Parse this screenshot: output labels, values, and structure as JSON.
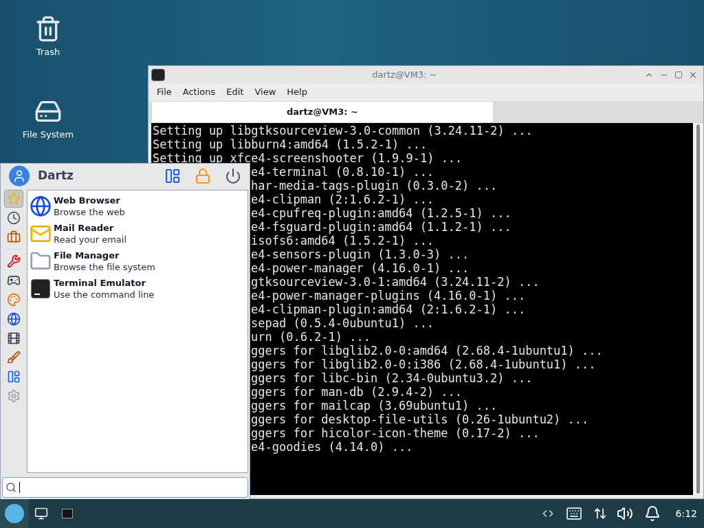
{
  "desktop_icons": [
    {
      "label": "Trash",
      "kind": "trash"
    },
    {
      "label": "File System",
      "kind": "drive"
    }
  ],
  "terminal": {
    "title": "dartz@VM3: ~",
    "menu": [
      "File",
      "Actions",
      "Edit",
      "View",
      "Help"
    ],
    "tabs": [
      {
        "label": "dartz@VM3: ~",
        "selected": true
      }
    ],
    "lines": [
      "Setting up libgtksourceview-3.0-common (3.24.11-2) ...",
      "Setting up libburn4:amd64 (1.5.2-1) ...",
      "Setting up xfce4-screenshooter (1.9.9-1) ..."
    ],
    "lines_right_of_menu": [
      {
        "text": "e4-terminal (0.8.10-1) ...",
        "covered": true
      },
      {
        "text": "har-media-tags-plugin (0.3.0-2) ...",
        "covered": true
      },
      {
        "text": "e4-clipman (2:1.6.2-1) ...",
        "covered": true
      },
      {
        "text": "e4-cpufreq-plugin:amd64 (1.2.5-1) ...",
        "covered": true
      },
      {
        "text": "e4-fsguard-plugin:amd64 (1.1.2-1) ...",
        "covered": true
      },
      {
        "text": "isofs6:amd64 (1.5.2-1) ...",
        "covered": true
      },
      {
        "text": "e4-sensors-plugin (1.3.0-3) ...",
        "covered": true
      },
      {
        "text": "e4-power-manager (4.16.0-1) ...",
        "covered": true
      },
      {
        "text": "gtksourceview-3.0-1:amd64 (3.24.11-2) ...",
        "covered": true
      },
      {
        "text": "e4-power-manager-plugins (4.16.0-1) ...",
        "covered": true
      },
      {
        "text": "e4-clipman-plugin:amd64 (2:1.6.2-1) ...",
        "covered": true
      },
      {
        "text": "sepad (0.5.4-0ubuntu1) ...",
        "covered": true
      },
      {
        "text": "urn (0.6.2-1) ...",
        "covered": true
      },
      {
        "text": "ggers for libglib2.0-0:amd64 (2.68.4-1ubuntu1) ...",
        "covered": true
      },
      {
        "text": "ggers for libglib2.0-0:i386 (2.68.4-1ubuntu1) ...",
        "covered": true
      },
      {
        "text": "ggers for libc-bin (2.34-0ubuntu3.2) ...",
        "covered": true
      },
      {
        "text": "ggers for man-db (2.9.4-2) ...",
        "covered": true
      },
      {
        "text": "ggers for mailcap (3.69ubuntu1) ...",
        "covered": true
      },
      {
        "text": "ggers for desktop-file-utils (0.26-1ubuntu2) ...",
        "covered": true
      },
      {
        "text": "ggers for hicolor-icon-theme (0.17-2) ...",
        "covered": true
      },
      {
        "text": "e4-goodies (4.14.0) ...",
        "covered": true
      }
    ]
  },
  "app_menu": {
    "user": "Dartz",
    "categories": [
      {
        "kind": "favorites",
        "selected": true
      },
      {
        "kind": "recent",
        "selected": false
      },
      {
        "kind": "all",
        "selected": false
      },
      {
        "kind": "accessories",
        "selected": false
      },
      {
        "kind": "games",
        "selected": false
      },
      {
        "kind": "graphics",
        "selected": false
      },
      {
        "kind": "internet",
        "selected": false
      },
      {
        "kind": "multimedia",
        "selected": false
      },
      {
        "kind": "office",
        "selected": false
      },
      {
        "kind": "settings",
        "selected": false
      },
      {
        "kind": "system",
        "selected": false
      }
    ],
    "apps": [
      {
        "name": "Web Browser",
        "description": "Browse the web",
        "kind": "browser"
      },
      {
        "name": "Mail Reader",
        "description": "Read your email",
        "kind": "mail"
      },
      {
        "name": "File Manager",
        "description": "Browse the file system",
        "kind": "files"
      },
      {
        "name": "Terminal Emulator",
        "description": "Use the command line",
        "kind": "terminal"
      }
    ]
  },
  "taskbar": {
    "clock": "6:12"
  }
}
